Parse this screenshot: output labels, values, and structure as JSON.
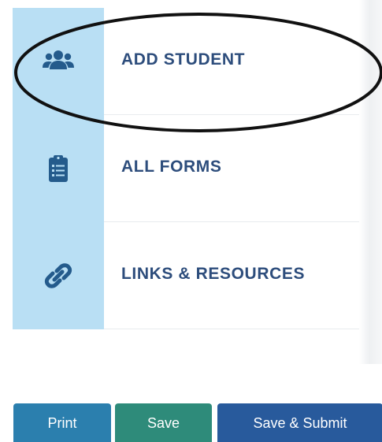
{
  "menu": {
    "items": [
      {
        "label": "ADD STUDENT",
        "icon": "users-icon"
      },
      {
        "label": "ALL FORMS",
        "icon": "clipboard-list-icon"
      },
      {
        "label": "LINKS & RESOURCES",
        "icon": "link-icon"
      }
    ]
  },
  "buttons": {
    "print_label": "Print",
    "save_label": "Save",
    "submit_label": "Save & Submit"
  },
  "colors": {
    "sidebar_icon_bg": "#b9dff4",
    "icon_color": "#245b8c",
    "menu_label": "#2d4d7c",
    "print_button": "#2b7fae",
    "save_button": "#2e8b7a",
    "submit_button": "#285a9c",
    "highlight_ellipse": "#111111"
  }
}
